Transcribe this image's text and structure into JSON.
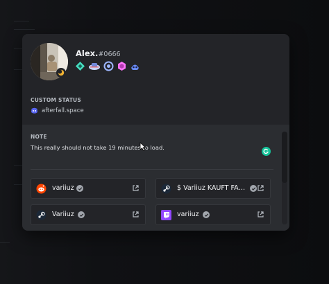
{
  "profile": {
    "display_name": "Alex.",
    "discriminator": "#0666",
    "badges": [
      "hypesquad-balance-badge",
      "early-supporter-badge",
      "nitro-badge",
      "boost-badge",
      "nitro-boost-badge"
    ]
  },
  "custom_status": {
    "title": "CUSTOM STATUS",
    "text": "afterfall.space",
    "icon": "discord-icon"
  },
  "note": {
    "title": "NOTE",
    "text": "This really should not take 19 minutes to load."
  },
  "connections": [
    {
      "platform": "reddit",
      "icon": "reddit-icon",
      "name": "variiuz",
      "verified": true
    },
    {
      "platform": "steam",
      "icon": "steam-icon",
      "name": "$ Variiuz KAUFT FAL...",
      "verified": true
    },
    {
      "platform": "steam",
      "icon": "steam-icon",
      "name": "Variiuz",
      "verified": true
    },
    {
      "platform": "twitch",
      "icon": "twitch-icon",
      "name": "variiuz",
      "verified": true
    }
  ],
  "colors": {
    "modal_bg": "#232428",
    "body_bg": "#2b2d31",
    "accent_green": "#15c39a",
    "reddit": "#ff4500",
    "twitch": "#9146ff"
  }
}
